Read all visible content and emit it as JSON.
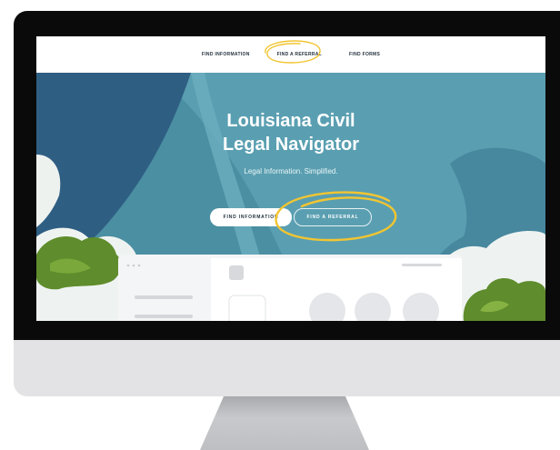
{
  "nav": {
    "find_information": "FIND INFORMATION",
    "find_a_referral": "FIND A REFERRAL",
    "find_forms": "FIND FORMS"
  },
  "hero": {
    "title_line1": "Louisiana Civil",
    "title_line2": "Legal Navigator",
    "subtitle": "Legal Information. Simplified.",
    "primary_button": "FIND INFORMATION",
    "secondary_button": "FIND A REFERRAL"
  },
  "colors": {
    "hero_background": "#4b8fa2",
    "highlight_circle": "#f2c531",
    "bezel": "#0a0a0a",
    "chin": "#e3e3e5"
  },
  "icons": [
    "window-dots-icon",
    "hand-drawn-circle-icon"
  ]
}
